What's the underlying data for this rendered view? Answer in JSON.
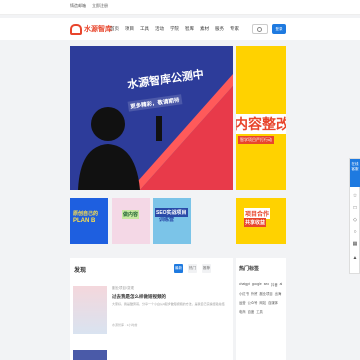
{
  "topbar": {
    "links": [
      "铸造邮箱",
      "立即注册"
    ]
  },
  "header": {
    "logo_text": "水源智库",
    "nav": [
      "首页",
      "项目",
      "工具",
      "活动",
      "学院",
      "智库",
      "素材",
      "服务",
      "专家"
    ],
    "login_label": "登录"
  },
  "banner": {
    "title": "水源智库公测中",
    "subtitle": "更多精彩，敬请期待"
  },
  "side_banner": {
    "title": "内容整改",
    "subtitle": "智学项目严打行动"
  },
  "thumbs": [
    {
      "title": "原创自己的",
      "title2": "PLAN B"
    },
    {
      "title": "做内容"
    },
    {
      "title": "SEO实战项目",
      "title2": "训练营"
    },
    {
      "title": "项目合作",
      "title2": "共享收益"
    }
  ],
  "main": {
    "section_title": "发现",
    "tabs": [
      "最新",
      "热门",
      "推荐"
    ],
    "article": {
      "category": "副业项目/变现",
      "title": "过去我是怎么样做短视频的",
      "desc": "大家好，我是酷男哥，分享一个小白从0起步做短视频的方法，是我自己实操经验总结",
      "meta": "水源智库 · 1小时前"
    }
  },
  "sidebar": {
    "title": "热门标签",
    "tags": [
      "chatgpt",
      "google",
      "seo",
      "抖音",
      "ai",
      "小红书",
      "外贸",
      "副业项目",
      "出海",
      "运营",
      "公众号",
      "网站",
      "自媒体",
      "电商",
      "百度",
      "工具"
    ]
  },
  "float_bar": {
    "top_label": "在线客服"
  }
}
